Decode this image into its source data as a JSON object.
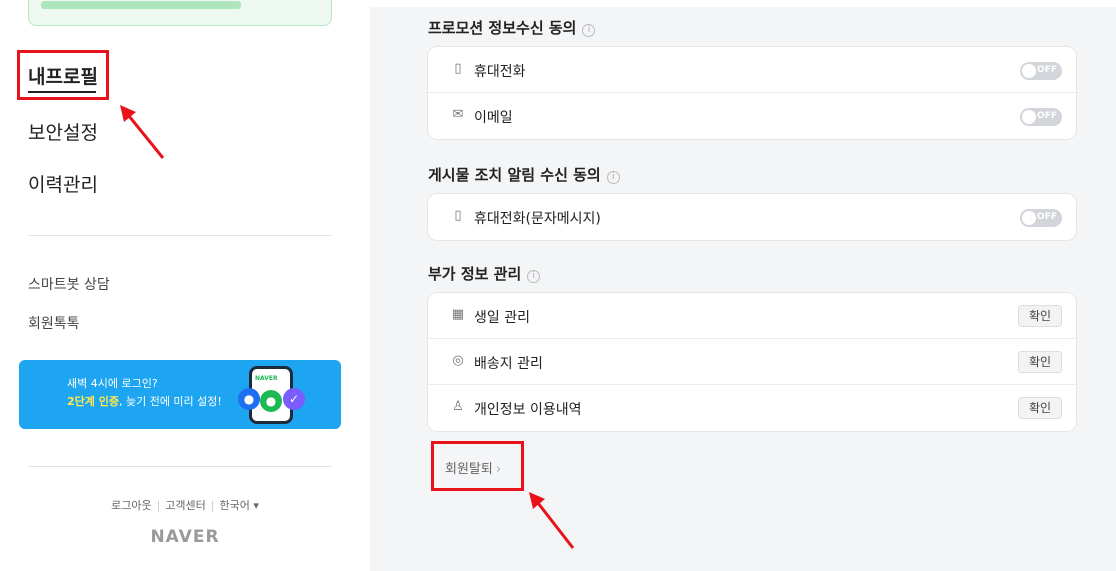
{
  "sidebar": {
    "nav": [
      {
        "label": "내프로필",
        "active": true
      },
      {
        "label": "보안설정",
        "active": false
      },
      {
        "label": "이력관리",
        "active": false
      }
    ],
    "links": [
      "스마트봇 상담",
      "회원톡톡"
    ],
    "promo": {
      "line1": "새벽 4시에 로그인?",
      "line2_highlight": "2단계 인증",
      "line2_rest": ", 늦기 전에 미리 설정!",
      "phone_badge": "NAVER",
      "bg_color": "#1ea5f2"
    },
    "footer": [
      "로그아웃",
      "고객센터",
      "한국어 ▾"
    ],
    "logo": "NAVER"
  },
  "sections": [
    {
      "title": "프로모션 정보수신 동의",
      "rows": [
        {
          "icon": "phone-icon",
          "glyph": "▯",
          "label": "휴대전화",
          "control": "toggle",
          "state": "OFF"
        },
        {
          "icon": "mail-icon",
          "glyph": "✉",
          "label": "이메일",
          "control": "toggle",
          "state": "OFF"
        }
      ]
    },
    {
      "title": "게시물 조치 알림 수신 동의",
      "rows": [
        {
          "icon": "phone-icon",
          "glyph": "▯",
          "label": "휴대전화(문자메시지)",
          "control": "toggle",
          "state": "OFF"
        }
      ]
    },
    {
      "title": "부가 정보 관리",
      "rows": [
        {
          "icon": "calendar-icon",
          "glyph": "▦",
          "label": "생일 관리",
          "control": "button",
          "button": "확인"
        },
        {
          "icon": "location-pin-icon",
          "glyph": "◎",
          "label": "배송지 관리",
          "control": "button",
          "button": "확인"
        },
        {
          "icon": "person-settings-icon",
          "glyph": "♙",
          "label": "개인정보 이용내역",
          "control": "button",
          "button": "확인"
        }
      ]
    }
  ],
  "withdraw": {
    "label": "회원탈퇴",
    "chevron": "›"
  },
  "info_glyph": "i",
  "annotation_color": "#e8121a"
}
